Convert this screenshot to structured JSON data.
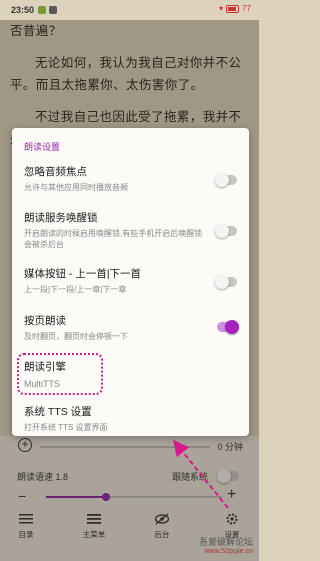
{
  "status": {
    "time": "23:50",
    "battery": "77"
  },
  "book": {
    "first_line": "否昔遍？",
    "paragraphs": [
      "无论如何，我认为我自己对你并不公平。而且太拖累你、太伤害你了。",
      "不过我自己也因此受了拖累，我并不是要解释，也不是为自己开脱。"
    ]
  },
  "dialog": {
    "title": "朗读设置",
    "options": [
      {
        "title": "忽略音频焦点",
        "sub": "允许与其他应用同时播放音频",
        "toggle": false
      },
      {
        "title": "朗读服务唤醒锁",
        "sub": "开启朗读的时候启用唤醒锁,有些手机开启后唤醒锁会被杀后台",
        "toggle": false
      },
      {
        "title": "媒体按钮 - 上一首|下一首",
        "sub": "上一段|下一段/上一章|下一章",
        "toggle": false
      },
      {
        "title": "按页朗读",
        "sub": "及时翻页，翻页时会停顿一下",
        "toggle": true
      },
      {
        "title": "朗读引擎",
        "sub": "MultiTTS"
      },
      {
        "title": "系统 TTS 设置",
        "sub": "打开系统 TTS 设置界面"
      }
    ]
  },
  "controls": {
    "timer_label": "0 分钟",
    "speed_label": "朗读语速 1.8",
    "follow_system_label": "跟随系统",
    "timer_progress": 0.05,
    "speed_progress": 0.34,
    "accent": "#8f22a7"
  },
  "nav": {
    "items": [
      {
        "label": "目录",
        "icon": "list-icon"
      },
      {
        "label": "主菜单",
        "icon": "menu-icon"
      },
      {
        "label": "后台",
        "icon": "eye-off-icon"
      },
      {
        "label": "设置",
        "icon": "gear-icon"
      }
    ]
  },
  "watermark": {
    "line1": "吾爱破解论坛",
    "line2": "www.52pojie.cn"
  }
}
